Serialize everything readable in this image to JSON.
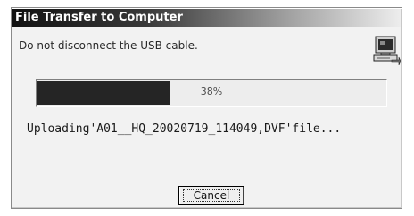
{
  "dialog": {
    "title": "File Transfer to Computer",
    "message": "Do not disconnect the USB cable.",
    "icon": "computer-transfer-icon"
  },
  "progress": {
    "percent": 38,
    "label": "38%"
  },
  "status_text": "Uploading'A01__HQ_20020719_114049,DVF'file...",
  "buttons": {
    "cancel_label": "Cancel"
  },
  "colors": {
    "progress_fill": "#252525",
    "dialog_background": "#f2f2f2"
  }
}
